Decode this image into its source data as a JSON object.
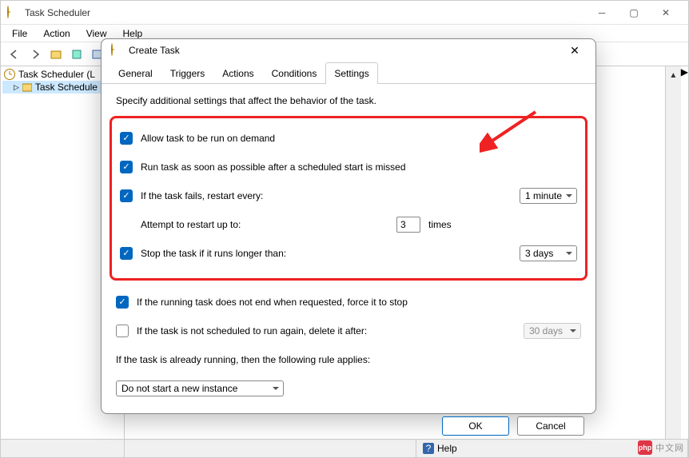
{
  "window": {
    "title": "Task Scheduler",
    "menus": [
      "File",
      "Action",
      "View",
      "Help"
    ]
  },
  "tree": {
    "root": "Task Scheduler (L",
    "child": "Task Schedule"
  },
  "status": {
    "help_label": "Help"
  },
  "dialog": {
    "title": "Create Task",
    "tabs": [
      "General",
      "Triggers",
      "Actions",
      "Conditions",
      "Settings"
    ],
    "active_tab": 4,
    "subtitle": "Specify additional settings that affect the behavior of the task.",
    "options": {
      "allow_on_demand": {
        "label": "Allow task to be run on demand",
        "checked": true
      },
      "run_asap": {
        "label": "Run task as soon as possible after a scheduled start is missed",
        "checked": true
      },
      "restart_fail": {
        "label": "If the task fails, restart every:",
        "checked": true,
        "value": "1 minute"
      },
      "restart_count": {
        "label": "Attempt to restart up to:",
        "value": "3",
        "suffix": "times"
      },
      "stop_long": {
        "label": "Stop the task if it runs longer than:",
        "checked": true,
        "value": "3 days"
      },
      "force_stop": {
        "label": "If the running task does not end when requested, force it to stop",
        "checked": true
      },
      "delete_after": {
        "label": "If the task is not scheduled to run again, delete it after:",
        "checked": false,
        "value": "30 days"
      },
      "rule_text": "If the task is already running, then the following rule applies:",
      "rule_value": "Do not start a new instance"
    },
    "buttons": {
      "ok": "OK",
      "cancel": "Cancel"
    }
  },
  "watermark": {
    "logo": "php",
    "text": "中文网"
  }
}
